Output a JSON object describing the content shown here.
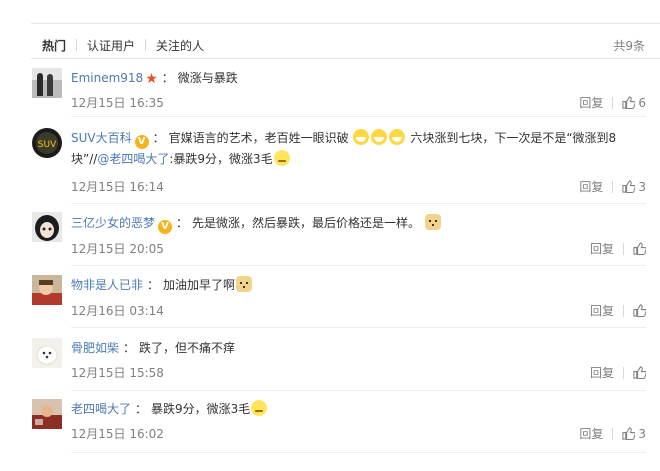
{
  "tabs": [
    {
      "label": "热门",
      "active": true
    },
    {
      "label": "认证用户",
      "active": false
    },
    {
      "label": "关注的人",
      "active": false
    }
  ],
  "total": "共9条",
  "reply_label": "回复",
  "comments": [
    {
      "user": "Eminem918",
      "colon": "：",
      "text": "微涨与暴跌",
      "date": "12月15日 16:35",
      "likes": "6"
    },
    {
      "user": "SUV大百科",
      "colon": "：",
      "text1": "官媒语言的艺术，老百姓一眼识破",
      "text2": "六块涨到七块，下一次是不是“微涨到8块”//",
      "mention": "@老四喝大了",
      "text3": ":暴跌9分，微涨3毛",
      "date": "12月15日 16:14",
      "likes": "3"
    },
    {
      "user": "三亿少女的恶梦",
      "colon": "：",
      "text": "先是微涨，然后暴跌，最后价格还是一样。",
      "date": "12月15日 20:05",
      "likes": ""
    },
    {
      "user": "物非是人已非",
      "colon": "：",
      "text": "加油加早了啊",
      "date": "12月16日 03:14",
      "likes": ""
    },
    {
      "user": "骨肥如柴",
      "colon": "：",
      "text": "跌了，但不痛不痒",
      "date": "12月15日 15:58",
      "likes": ""
    },
    {
      "user": "老四喝大了",
      "colon": "：",
      "text": "暴跌9分，微涨3毛",
      "date": "12月15日 16:02",
      "likes": "3"
    }
  ],
  "colors": {
    "link": "#4b79b5",
    "meta": "#808080",
    "star": "#e94f2a",
    "verified": "#f8b21b"
  }
}
